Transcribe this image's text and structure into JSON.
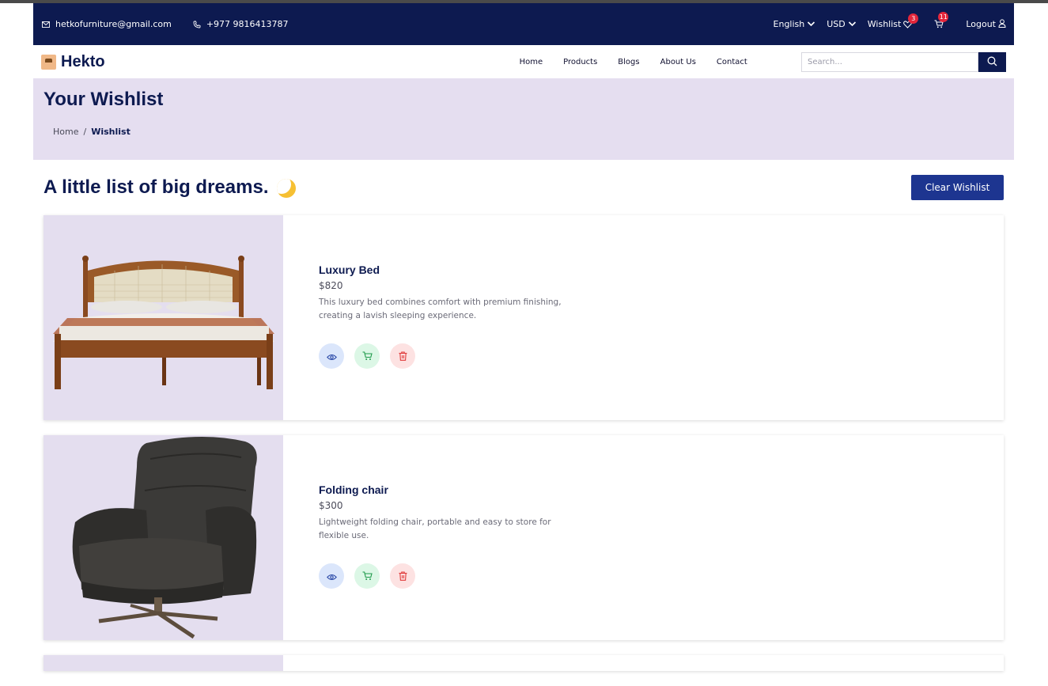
{
  "topbar": {
    "email": "hetkofurniture@gmail.com",
    "phone": "+977 9816413787",
    "language": "English",
    "currency": "USD",
    "wishlist_label": "Wishlist",
    "wishlist_count": "3",
    "cart_count": "11",
    "logout_label": "Logout"
  },
  "nav": {
    "logo": "Hekto",
    "items": [
      "Home",
      "Products",
      "Blogs",
      "About Us",
      "Contact"
    ],
    "search_placeholder": "Search..."
  },
  "hero": {
    "title": "Your Wishlist",
    "breadcrumb_home": "Home",
    "breadcrumb_sep": "/",
    "breadcrumb_current": "Wishlist"
  },
  "section": {
    "title": "A little list of big dreams.",
    "clear_label": "Clear Wishlist"
  },
  "products": [
    {
      "name": "Luxury Bed",
      "price": "$820",
      "desc": "This luxury bed combines comfort with premium finishing, creating a lavish sleeping experience."
    },
    {
      "name": "Folding chair",
      "price": "$300",
      "desc": "Lightweight folding chair, portable and easy to store for flexible use."
    }
  ],
  "colors": {
    "navy": "#0d1a50",
    "hero_bg": "#e5def0",
    "button": "#1d3590",
    "badge": "#e3263b"
  },
  "icons": [
    "mail-icon",
    "phone-icon",
    "chevron-down-icon",
    "heart-icon",
    "cart-icon",
    "user-icon",
    "search-icon",
    "eye-icon",
    "trash-icon",
    "moon-icon"
  ]
}
